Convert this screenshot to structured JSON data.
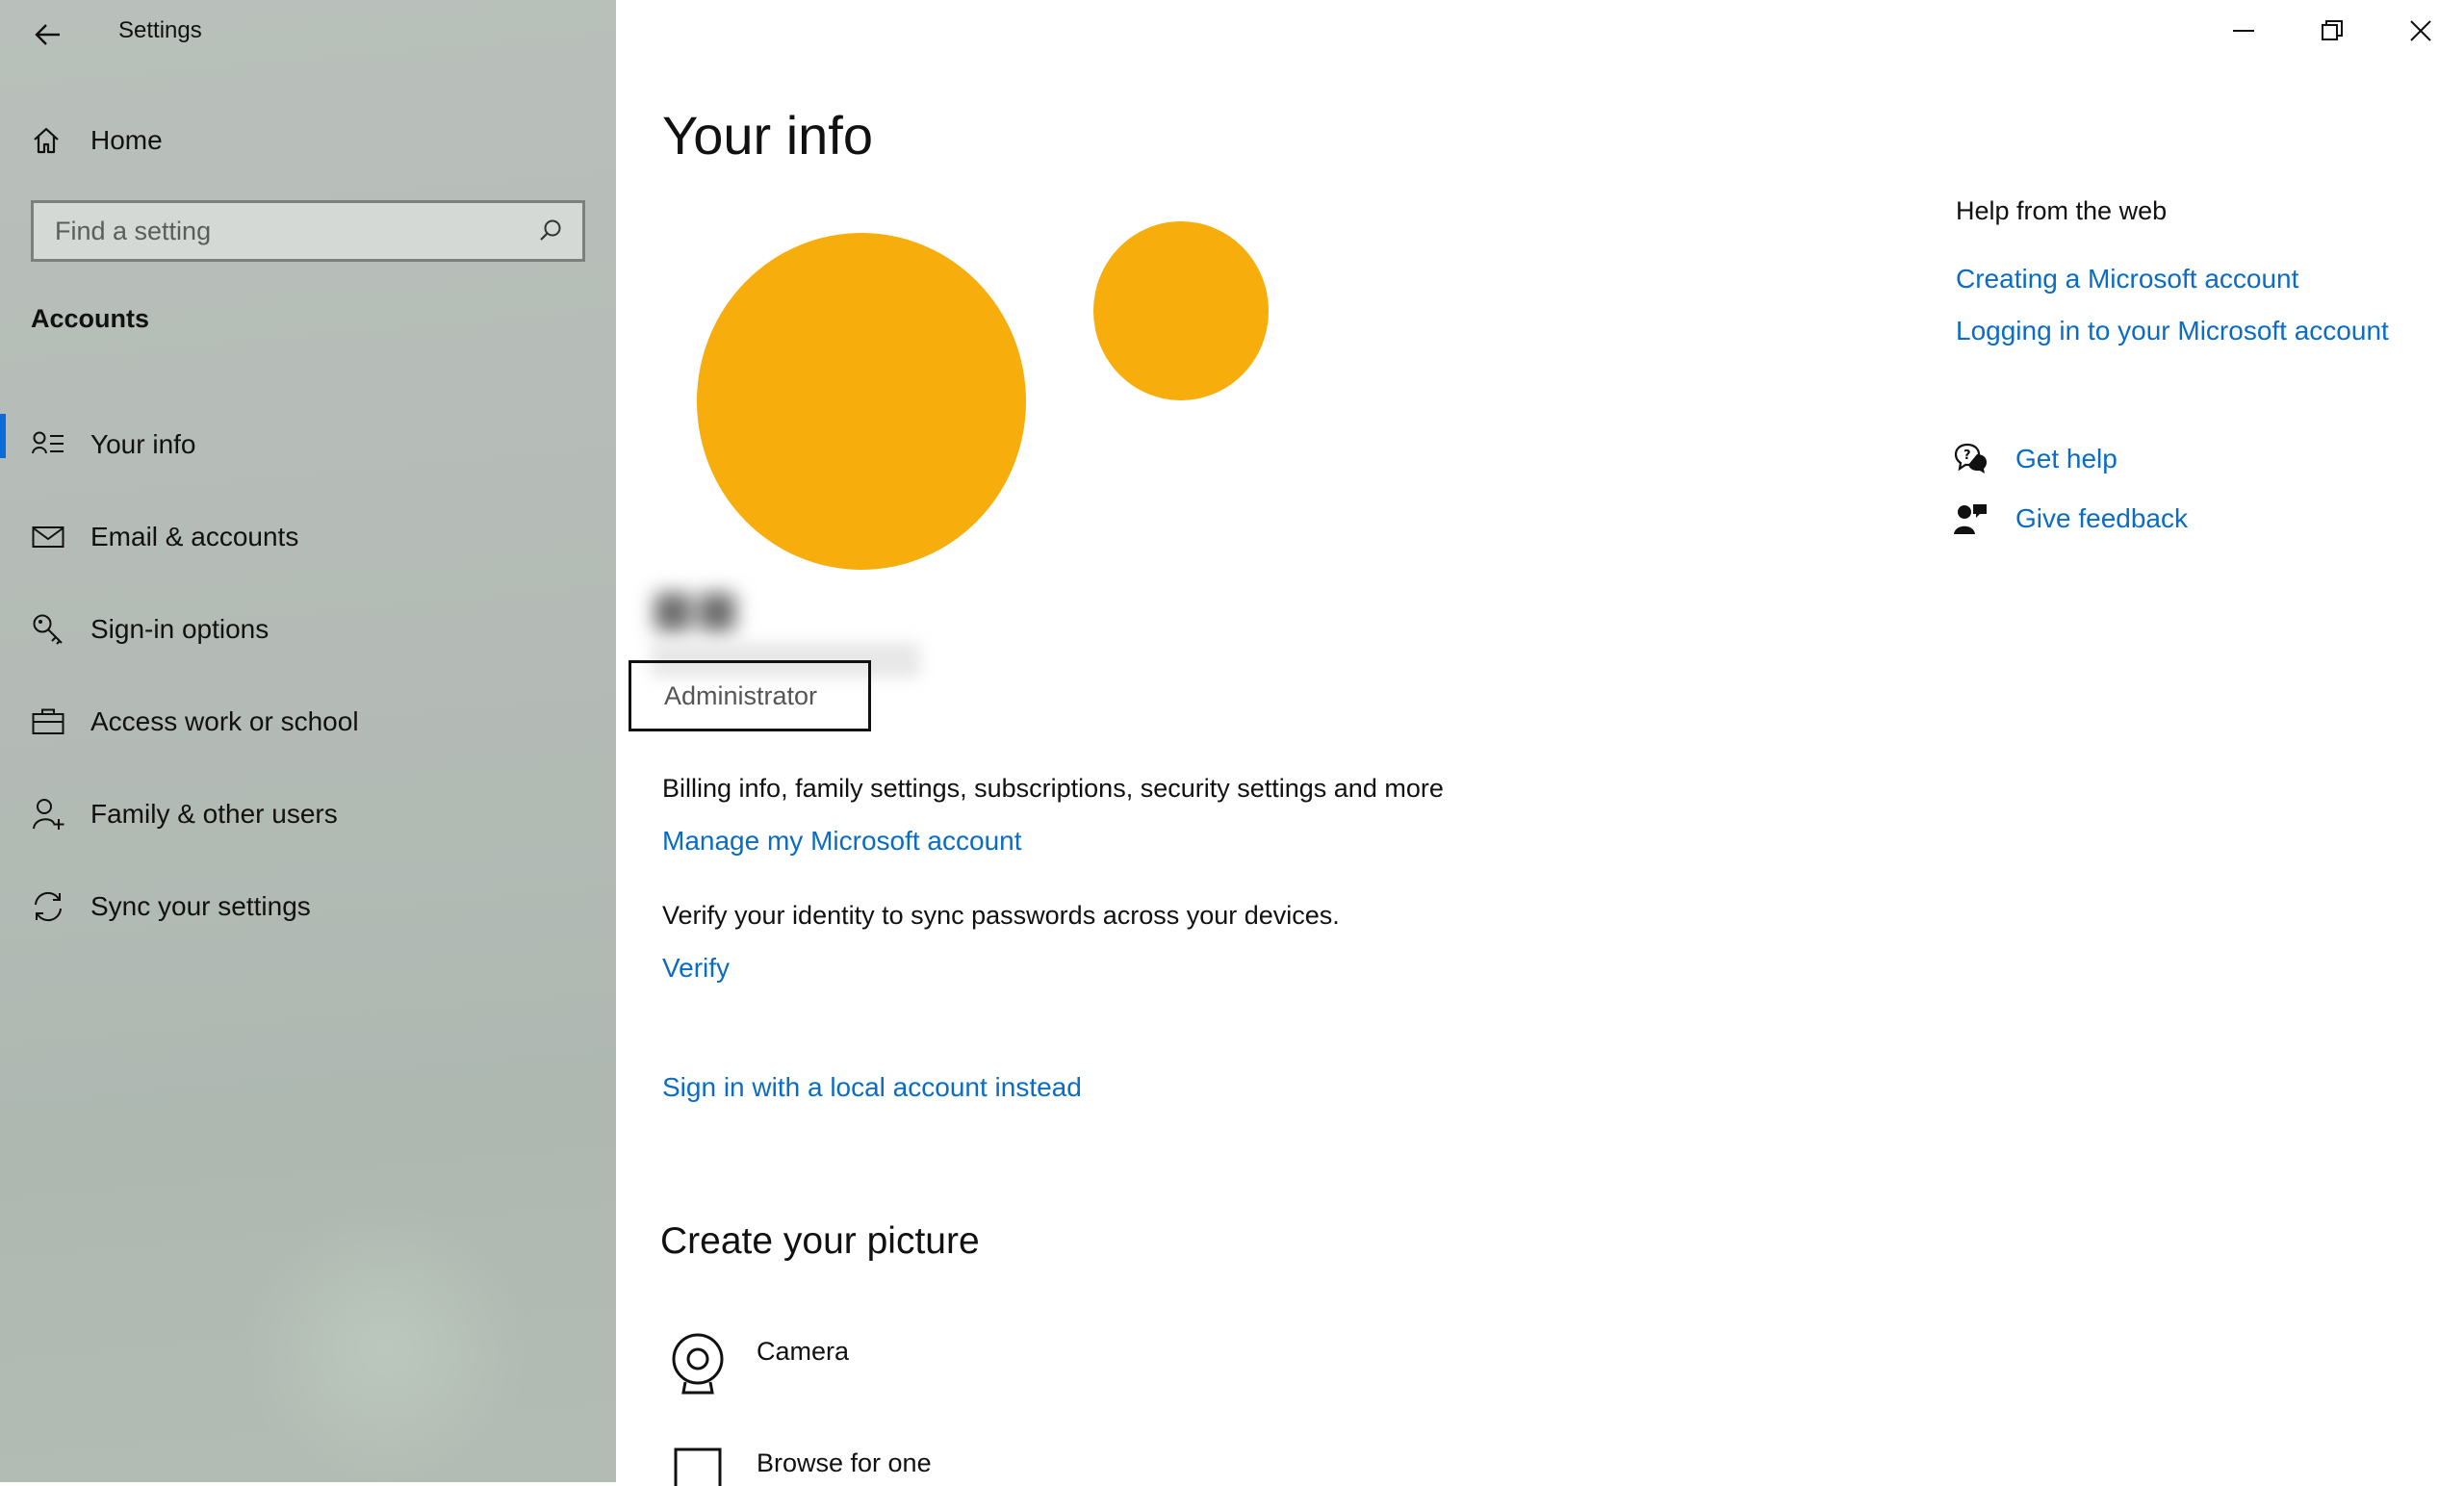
{
  "window": {
    "app_title": "Settings"
  },
  "sidebar": {
    "home_label": "Home",
    "search_placeholder": "Find a setting",
    "section_title": "Accounts",
    "items": [
      {
        "label": "Your info",
        "icon": "user-info-icon",
        "active": true
      },
      {
        "label": "Email & accounts",
        "icon": "mail-icon",
        "active": false
      },
      {
        "label": "Sign-in options",
        "icon": "key-icon",
        "active": false
      },
      {
        "label": "Access work or school",
        "icon": "briefcase-icon",
        "active": false
      },
      {
        "label": "Family & other users",
        "icon": "add-user-icon",
        "active": false
      },
      {
        "label": "Sync your settings",
        "icon": "sync-icon",
        "active": false
      }
    ]
  },
  "main": {
    "title": "Your info",
    "role": "Administrator",
    "billing_text": "Billing info, family settings, subscriptions, security settings and more",
    "manage_link": "Manage my Microsoft account",
    "verify_text": "Verify your identity to sync passwords across your devices.",
    "verify_link": "Verify",
    "local_account_link": "Sign in with a local account instead",
    "picture_heading": "Create your picture",
    "picture_options": [
      {
        "label": "Camera",
        "icon": "camera-icon"
      },
      {
        "label": "Browse for one",
        "icon": "browse-icon"
      }
    ]
  },
  "help": {
    "title": "Help from the web",
    "links": [
      "Creating a Microsoft account",
      "Logging in to your Microsoft account"
    ],
    "get_help": "Get help",
    "give_feedback": "Give feedback"
  },
  "colors": {
    "accent": "#0a6cc4",
    "avatar": "#f7ad0b",
    "active_indicator": "#0a6cd6"
  }
}
